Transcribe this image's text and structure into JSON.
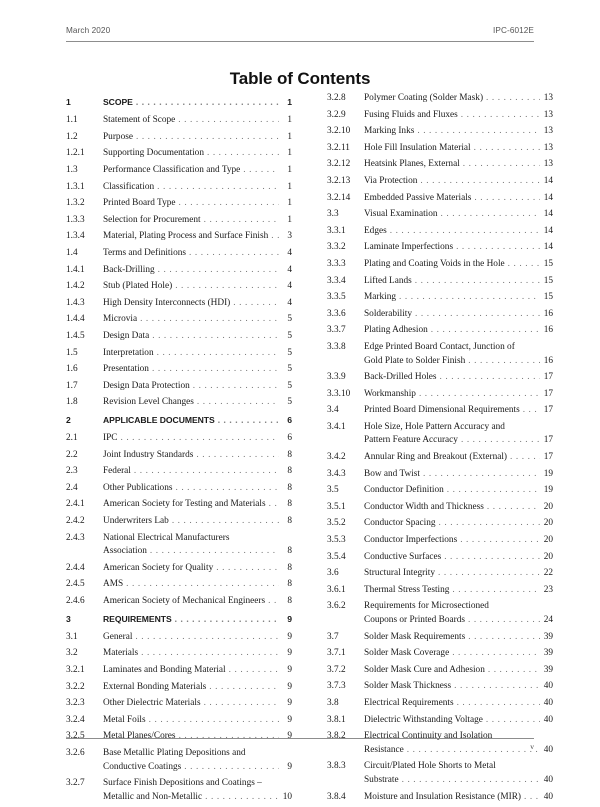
{
  "header": {
    "date": "March 2020",
    "document_id": "IPC-6012E"
  },
  "title": "Table of Contents",
  "footer": {
    "page_number": "v"
  },
  "columns": {
    "left": [
      {
        "number": "1",
        "lines": [
          "SCOPE"
        ],
        "page": "1",
        "major": true
      },
      {
        "number": "1.1",
        "lines": [
          "Statement of Scope"
        ],
        "page": "1"
      },
      {
        "number": "1.2",
        "lines": [
          "Purpose"
        ],
        "page": "1"
      },
      {
        "number": "1.2.1",
        "lines": [
          "Supporting Documentation"
        ],
        "page": "1"
      },
      {
        "number": "1.3",
        "lines": [
          "Performance Classification and Type"
        ],
        "page": "1"
      },
      {
        "number": "1.3.1",
        "lines": [
          "Classification"
        ],
        "page": "1"
      },
      {
        "number": "1.3.2",
        "lines": [
          "Printed Board Type"
        ],
        "page": "1"
      },
      {
        "number": "1.3.3",
        "lines": [
          "Selection for Procurement"
        ],
        "page": "1"
      },
      {
        "number": "1.3.4",
        "lines": [
          "Material, Plating Process and Surface Finish"
        ],
        "page": "3"
      },
      {
        "number": "1.4",
        "lines": [
          "Terms and Definitions"
        ],
        "page": "4"
      },
      {
        "number": "1.4.1",
        "lines": [
          "Back-Drilling"
        ],
        "page": "4"
      },
      {
        "number": "1.4.2",
        "lines": [
          "Stub (Plated Hole)"
        ],
        "page": "4"
      },
      {
        "number": "1.4.3",
        "lines": [
          "High Density Interconnects (HDI)"
        ],
        "page": "4"
      },
      {
        "number": "1.4.4",
        "lines": [
          "Microvia"
        ],
        "page": "5"
      },
      {
        "number": "1.4.5",
        "lines": [
          "Design Data"
        ],
        "page": "5"
      },
      {
        "number": "1.5",
        "lines": [
          "Interpretation"
        ],
        "page": "5"
      },
      {
        "number": "1.6",
        "lines": [
          "Presentation"
        ],
        "page": "5"
      },
      {
        "number": "1.7",
        "lines": [
          "Design Data Protection"
        ],
        "page": "5"
      },
      {
        "number": "1.8",
        "lines": [
          "Revision Level Changes"
        ],
        "page": "5"
      },
      {
        "number": "2",
        "lines": [
          "APPLICABLE DOCUMENTS"
        ],
        "page": "6",
        "major": true
      },
      {
        "number": "2.1",
        "lines": [
          "IPC"
        ],
        "page": "6"
      },
      {
        "number": "2.2",
        "lines": [
          "Joint Industry Standards"
        ],
        "page": "8"
      },
      {
        "number": "2.3",
        "lines": [
          "Federal"
        ],
        "page": "8"
      },
      {
        "number": "2.4",
        "lines": [
          "Other Publications"
        ],
        "page": "8"
      },
      {
        "number": "2.4.1",
        "lines": [
          "American Society for Testing and Materials"
        ],
        "page": "8"
      },
      {
        "number": "2.4.2",
        "lines": [
          "Underwriters Lab"
        ],
        "page": "8"
      },
      {
        "number": "2.4.3",
        "lines": [
          "National Electrical Manufacturers",
          "Association"
        ],
        "page": "8"
      },
      {
        "number": "2.4.4",
        "lines": [
          "American Society for Quality"
        ],
        "page": "8"
      },
      {
        "number": "2.4.5",
        "lines": [
          "AMS"
        ],
        "page": "8"
      },
      {
        "number": "2.4.6",
        "lines": [
          "American Society of Mechanical Engineers"
        ],
        "page": "8"
      },
      {
        "number": "3",
        "lines": [
          "REQUIREMENTS"
        ],
        "page": "9",
        "major": true
      },
      {
        "number": "3.1",
        "lines": [
          "General"
        ],
        "page": "9"
      },
      {
        "number": "3.2",
        "lines": [
          "Materials"
        ],
        "page": "9"
      },
      {
        "number": "3.2.1",
        "lines": [
          "Laminates and Bonding Material"
        ],
        "page": "9"
      },
      {
        "number": "3.2.2",
        "lines": [
          "External Bonding Materials"
        ],
        "page": "9"
      },
      {
        "number": "3.2.3",
        "lines": [
          "Other Dielectric Materials"
        ],
        "page": "9"
      },
      {
        "number": "3.2.4",
        "lines": [
          "Metal Foils"
        ],
        "page": "9"
      },
      {
        "number": "3.2.5",
        "lines": [
          "Metal Planes/Cores"
        ],
        "page": "9"
      },
      {
        "number": "3.2.6",
        "lines": [
          "Base Metallic Plating Depositions and",
          "Conductive Coatings"
        ],
        "page": "9"
      },
      {
        "number": "3.2.7",
        "lines": [
          "Surface Finish Depositions and Coatings –",
          "Metallic and Non-Metallic"
        ],
        "page": "10"
      }
    ],
    "right": [
      {
        "number": "3.2.8",
        "lines": [
          "Polymer Coating (Solder Mask)"
        ],
        "page": "13"
      },
      {
        "number": "3.2.9",
        "lines": [
          "Fusing Fluids and Fluxes"
        ],
        "page": "13"
      },
      {
        "number": "3.2.10",
        "lines": [
          "Marking Inks"
        ],
        "page": "13"
      },
      {
        "number": "3.2.11",
        "lines": [
          "Hole Fill Insulation Material"
        ],
        "page": "13"
      },
      {
        "number": "3.2.12",
        "lines": [
          "Heatsink Planes, External"
        ],
        "page": "13"
      },
      {
        "number": "3.2.13",
        "lines": [
          "Via Protection"
        ],
        "page": "14"
      },
      {
        "number": "3.2.14",
        "lines": [
          "Embedded Passive Materials"
        ],
        "page": "14"
      },
      {
        "number": "3.3",
        "lines": [
          "Visual Examination"
        ],
        "page": "14"
      },
      {
        "number": "3.3.1",
        "lines": [
          "Edges"
        ],
        "page": "14"
      },
      {
        "number": "3.3.2",
        "lines": [
          "Laminate Imperfections"
        ],
        "page": "14"
      },
      {
        "number": "3.3.3",
        "lines": [
          "Plating and Coating Voids in the Hole"
        ],
        "page": "15"
      },
      {
        "number": "3.3.4",
        "lines": [
          "Lifted Lands"
        ],
        "page": "15"
      },
      {
        "number": "3.3.5",
        "lines": [
          "Marking"
        ],
        "page": "15"
      },
      {
        "number": "3.3.6",
        "lines": [
          "Solderability"
        ],
        "page": "16"
      },
      {
        "number": "3.3.7",
        "lines": [
          "Plating Adhesion"
        ],
        "page": "16"
      },
      {
        "number": "3.3.8",
        "lines": [
          "Edge Printed Board Contact, Junction of",
          "Gold Plate to Solder Finish"
        ],
        "page": "16"
      },
      {
        "number": "3.3.9",
        "lines": [
          "Back-Drilled Holes"
        ],
        "page": "17"
      },
      {
        "number": "3.3.10",
        "lines": [
          "Workmanship"
        ],
        "page": "17"
      },
      {
        "number": "3.4",
        "lines": [
          "Printed Board Dimensional Requirements"
        ],
        "page": "17"
      },
      {
        "number": "3.4.1",
        "lines": [
          "Hole Size, Hole Pattern Accuracy and",
          "Pattern Feature Accuracy"
        ],
        "page": "17"
      },
      {
        "number": "3.4.2",
        "lines": [
          "Annular Ring and Breakout (External)"
        ],
        "page": "17"
      },
      {
        "number": "3.4.3",
        "lines": [
          "Bow and Twist"
        ],
        "page": "19"
      },
      {
        "number": "3.5",
        "lines": [
          "Conductor Definition"
        ],
        "page": "19"
      },
      {
        "number": "3.5.1",
        "lines": [
          "Conductor Width and Thickness"
        ],
        "page": "20"
      },
      {
        "number": "3.5.2",
        "lines": [
          "Conductor Spacing"
        ],
        "page": "20"
      },
      {
        "number": "3.5.3",
        "lines": [
          "Conductor Imperfections"
        ],
        "page": "20"
      },
      {
        "number": "3.5.4",
        "lines": [
          "Conductive Surfaces"
        ],
        "page": "20"
      },
      {
        "number": "3.6",
        "lines": [
          "Structural Integrity"
        ],
        "page": "22"
      },
      {
        "number": "3.6.1",
        "lines": [
          "Thermal Stress Testing"
        ],
        "page": "23"
      },
      {
        "number": "3.6.2",
        "lines": [
          "Requirements for Microsectioned",
          "Coupons or Printed Boards"
        ],
        "page": "24"
      },
      {
        "number": "3.7",
        "lines": [
          "Solder Mask Requirements"
        ],
        "page": "39"
      },
      {
        "number": "3.7.1",
        "lines": [
          "Solder Mask Coverage"
        ],
        "page": "39"
      },
      {
        "number": "3.7.2",
        "lines": [
          "Solder Mask Cure and Adhesion"
        ],
        "page": "39"
      },
      {
        "number": "3.7.3",
        "lines": [
          "Solder Mask Thickness"
        ],
        "page": "40"
      },
      {
        "number": "3.8",
        "lines": [
          "Electrical Requirements"
        ],
        "page": "40"
      },
      {
        "number": "3.8.1",
        "lines": [
          "Dielectric Withstanding Voltage"
        ],
        "page": "40"
      },
      {
        "number": "3.8.2",
        "lines": [
          "Electrical Continuity and Isolation",
          "Resistance"
        ],
        "page": "40"
      },
      {
        "number": "3.8.3",
        "lines": [
          "Circuit/Plated Hole Shorts to Metal",
          "Substrate"
        ],
        "page": "40"
      },
      {
        "number": "3.8.4",
        "lines": [
          "Moisture and Insulation Resistance (MIR)"
        ],
        "page": "40"
      }
    ]
  }
}
